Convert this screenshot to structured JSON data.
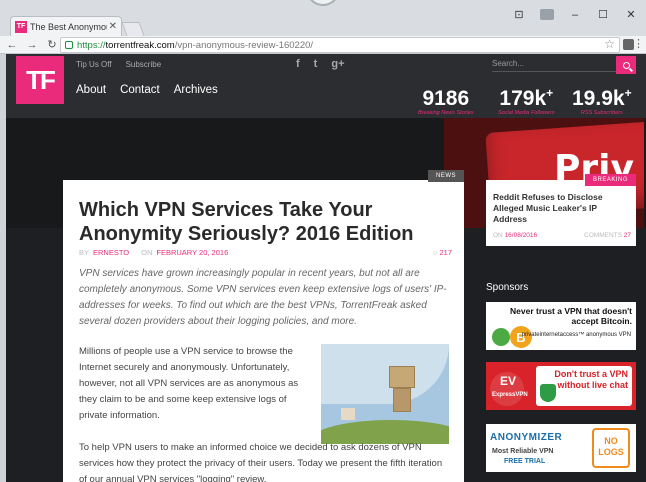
{
  "browser": {
    "tab_title": "The Best Anonymous VPN",
    "tab_favicon": "TF",
    "url_scheme": "https://",
    "url_host": "torrentfreak.com",
    "url_path": "/vpn-anonymous-review-160220/"
  },
  "header": {
    "logo": "TF",
    "top_links": [
      "Tip Us Off",
      "Subscribe"
    ],
    "nav": [
      "About",
      "Contact",
      "Archives"
    ],
    "social_icons": [
      "facebook-icon",
      "twitter-icon",
      "google-plus-icon"
    ],
    "social_glyphs": [
      "f",
      "t",
      "g+"
    ],
    "search_placeholder": "Search...",
    "stats": [
      {
        "value": "9186",
        "plus": "",
        "label": "Breaking News Stories"
      },
      {
        "value": "179k",
        "plus": "+",
        "label": "Social Media Followers"
      },
      {
        "value": "19.9k",
        "plus": "+",
        "label": "RSS Subscribers"
      }
    ]
  },
  "hero": {
    "key_word": "Priv"
  },
  "article": {
    "tag": "NEWS",
    "title": "Which VPN Services Take Your Anonymity Seriously? 2016 Edition",
    "by_label": "BY",
    "author": "ERNESTO",
    "on_label": "ON",
    "date": "FEBRUARY 20, 2016",
    "comments": "217",
    "lead": "VPN services have grown increasingly popular in recent years, but not all are completely anonymous. Some VPN services even keep extensive logs of users' IP-addresses for weeks. To find out which are the best VPNs, TorrentFreak asked several dozen providers about their logging policies, and more.",
    "p1": "Millions of people use a VPN service to browse the Internet securely and anonymously. Unfortunately, however, not all VPN services are as anonymous as they claim to be and some keep extensive logs of private information.",
    "p2": "To help VPN users to make an informed choice we decided to ask dozens of VPN services how they protect the privacy of their users. Today we present the fifth iteration of our annual VPN services \"logging\" review."
  },
  "breaking": {
    "tag": "BREAKING",
    "title": "Reddit Refuses to Disclose Alleged Music Leaker's IP Address",
    "on_label": "ON",
    "date": "16/08/2016",
    "comments_label": "COMMENTS",
    "comments": "27"
  },
  "sponsors": {
    "heading": "Sponsors",
    "ad1_text": "Never trust a VPN that doesn't accept Bitcoin.",
    "ad1_sub": "privateinternetaccess™ anonymous VPN",
    "ad1_coin": "B",
    "ad2_mark": "EV",
    "ad2_brand": "ExpressVPN",
    "ad2_text": "Don't trust a VPN without live chat",
    "ad3_brand": "ANONYMIZER",
    "ad3_line1": "Most Reliable VPN",
    "ad3_line2": "FREE TRIAL",
    "ad3_badge": "NO LOGS"
  },
  "colors": {
    "accent": "#ea2b7b",
    "header_bg": "#2b2d30",
    "page_bg": "#1d1f22"
  }
}
